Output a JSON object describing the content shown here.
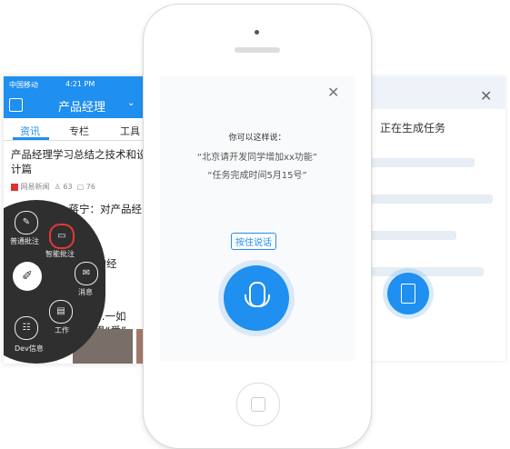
{
  "left": {
    "status": {
      "carrier": "中国移动",
      "time": "4:21 PM"
    },
    "nav": {
      "title": "产品经理"
    },
    "tabs": [
      {
        "label": "资讯"
      },
      {
        "label": "专栏"
      },
      {
        "label": "工具"
      }
    ],
    "articles": [
      {
        "title": "产品经理学习总结之技术和设计篇",
        "source": "网易新闻",
        "likes": "63",
        "comments": "76"
      },
      {
        "title": "…蒋宁：对产品经理的",
        "source": "",
        "likes": "",
        "comments": ""
      },
      {
        "title": "…的经",
        "source": "",
        "likes": "",
        "comments": ""
      },
      {
        "title": "…一如果“爱”",
        "source": "",
        "likes": "",
        "comments": ""
      }
    ],
    "wheel": {
      "items": [
        {
          "label": "普通批注",
          "icon": "note-icon"
        },
        {
          "label": "智能批注",
          "icon": "smart-note-icon"
        },
        {
          "label": "消息",
          "icon": "message-icon"
        },
        {
          "label": "工作",
          "icon": "work-icon"
        },
        {
          "label": "Dev信息",
          "icon": "dev-info-icon"
        }
      ],
      "center_icon": "edit-icon"
    }
  },
  "middle": {
    "prompt": "你可以这样说：",
    "examples": [
      "“北京请开发同学增加xx功能”",
      "“任务完成时间5月15号”"
    ],
    "hold_label": "按住说话"
  },
  "right": {
    "generating": "正在生成任务"
  }
}
